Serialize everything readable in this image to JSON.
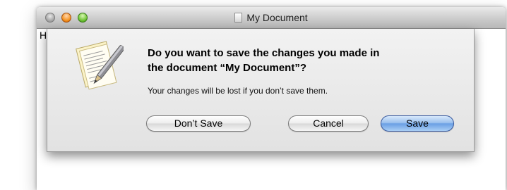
{
  "window": {
    "title": "My Document",
    "content_text": "H"
  },
  "dialog": {
    "heading_line1": "Do you want to save the changes you made in",
    "heading_line2": "the document “My Document”?",
    "informative_text": "Your changes will be lost if you don’t save them.",
    "buttons": {
      "dont_save": "Don’t Save",
      "cancel": "Cancel",
      "save": "Save"
    },
    "default_button_color": "#6a9fe4",
    "icon": "text-document-pen-icon"
  }
}
